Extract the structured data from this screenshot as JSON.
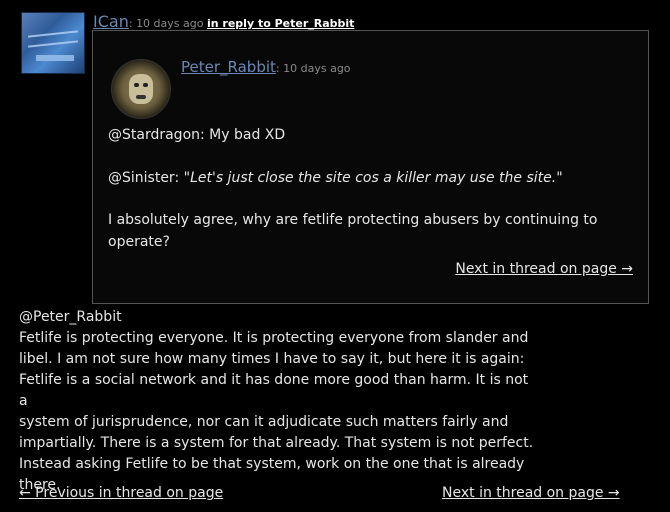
{
  "comment": {
    "author": "ICan",
    "time": "10 days ago",
    "reply_link": "in reply to Peter_Rabbit",
    "body_lines": [
      "@Peter_Rabbit",
      "Fetlife is protecting everyone. It is protecting everyone from slander and",
      "libel. I am not sure how many times I have to say it, but here it is again:",
      "Fetlife is a social network and it has done more good than harm. It is not a",
      "system of jurisprudence, nor can it adjudicate such matters fairly and",
      "impartially. There is a system for that already. That system is not perfect.",
      "Instead asking Fetlife to be that system, work on the one that is already",
      "there."
    ]
  },
  "quoted": {
    "author": "Peter_Rabbit",
    "time": "10 days ago",
    "line1": "@Stardragon: My bad XD",
    "line2_prefix": "@Sinister: ",
    "line2_quote": "\"Let's just close the site cos a killer may use the site.\"",
    "line3a": "I absolutely agree, why are fetlife protecting abusers by continuing to",
    "line3b": "operate?",
    "next_link": "Next in thread on page →"
  },
  "nav": {
    "prev": "← Previous in thread on page",
    "next": "Next in thread on page →"
  },
  "icons": {
    "main_avatar": "user-avatar-blue-sign",
    "quoted_avatar": "user-avatar-lion-face"
  }
}
